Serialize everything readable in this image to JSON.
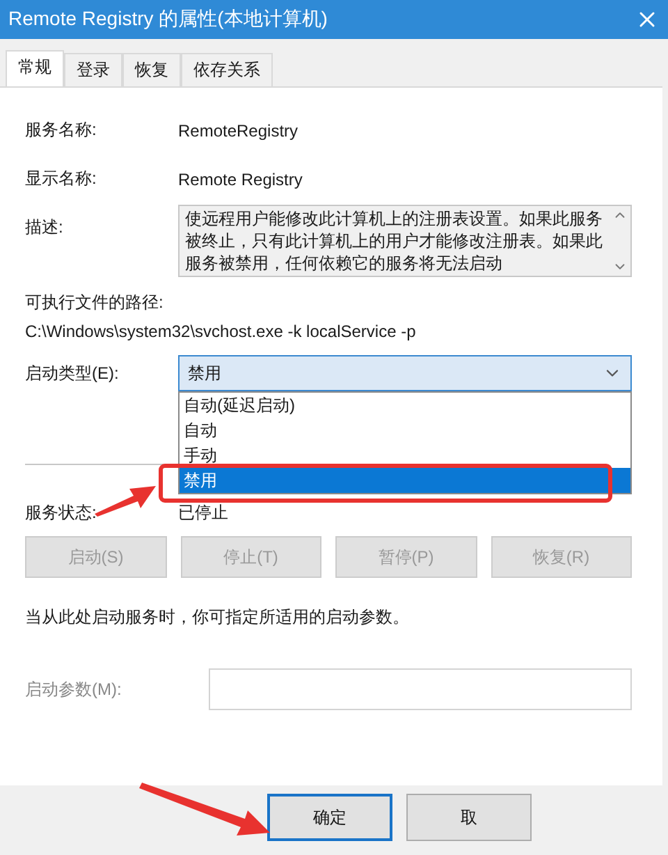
{
  "window": {
    "title": "Remote Registry 的属性(本地计算机)"
  },
  "tabs": [
    {
      "label": "常规",
      "selected": true
    },
    {
      "label": "登录",
      "selected": false
    },
    {
      "label": "恢复",
      "selected": false
    },
    {
      "label": "依存关系",
      "selected": false
    }
  ],
  "service_name": {
    "label": "服务名称:",
    "value": "RemoteRegistry"
  },
  "display_name": {
    "label": "显示名称:",
    "value": "Remote Registry"
  },
  "description": {
    "label": "描述:",
    "value": "使远程用户能修改此计算机上的注册表设置。如果此服务被终止，只有此计算机上的用户才能修改注册表。如果此服务被禁用，任何依赖它的服务将无法启动"
  },
  "path": {
    "label": "可执行文件的路径:",
    "value": "C:\\Windows\\system32\\svchost.exe -k localService -p"
  },
  "startup_type": {
    "label": "启动类型(E):",
    "value": "禁用",
    "expanded": true,
    "options": [
      {
        "label": "自动(延迟启动)",
        "selected": false
      },
      {
        "label": "自动",
        "selected": false
      },
      {
        "label": "手动",
        "selected": false
      },
      {
        "label": "禁用",
        "selected": true
      }
    ]
  },
  "service_status": {
    "label": "服务状态:",
    "value": "已停止"
  },
  "service_buttons": [
    {
      "label": "启动(S)",
      "disabled": true
    },
    {
      "label": "停止(T)",
      "disabled": true
    },
    {
      "label": "暂停(P)",
      "disabled": true
    },
    {
      "label": "恢复(R)",
      "disabled": true
    }
  ],
  "hint": "当从此处启动服务时，你可指定所适用的启动参数。",
  "start_params": {
    "label": "启动参数(M):",
    "disabled": true
  },
  "footer_buttons": [
    {
      "label": "确定",
      "focused": true
    },
    {
      "label": "取",
      "focused": false
    }
  ]
}
